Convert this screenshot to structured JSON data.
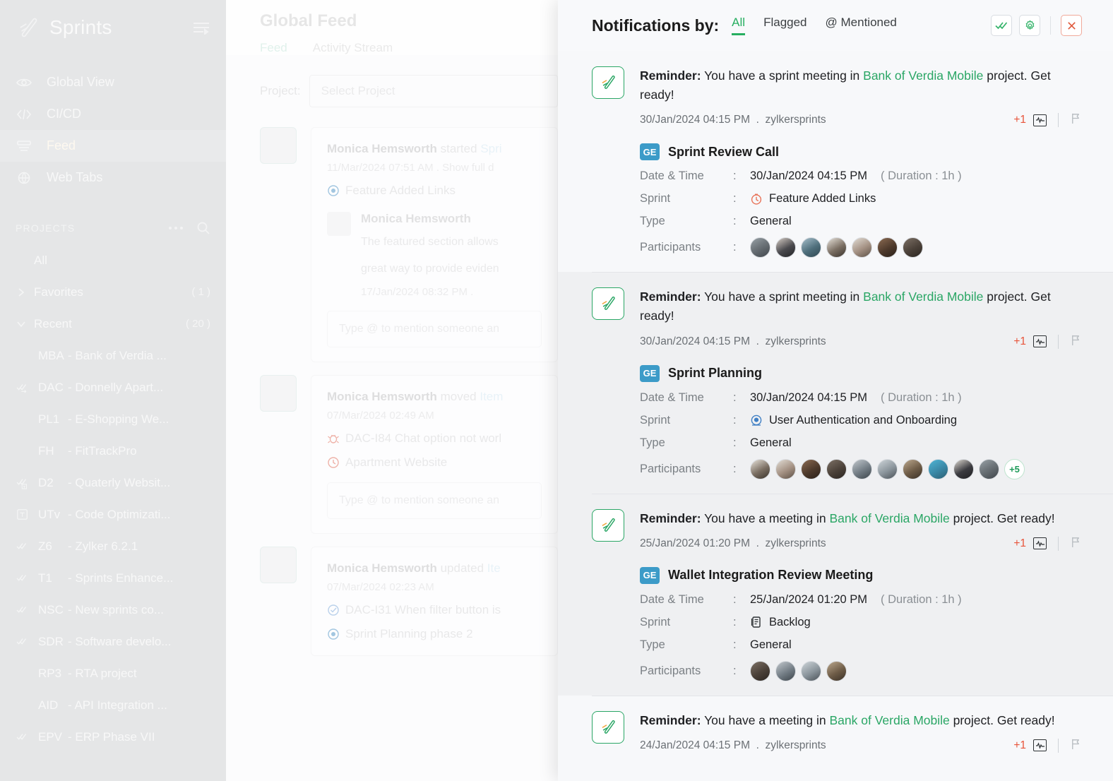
{
  "sidebar": {
    "brand": "Sprints",
    "nav": [
      {
        "label": "Global View",
        "icon": "eye-icon",
        "active": false
      },
      {
        "label": "CI/CD",
        "icon": "code-icon",
        "active": false
      },
      {
        "label": "Feed",
        "icon": "feed-icon",
        "active": true
      },
      {
        "label": "Web Tabs",
        "icon": "globe-icon",
        "active": false
      }
    ],
    "section_label": "PROJECTS",
    "section_actions": [
      "more-icon",
      "search-icon"
    ],
    "groups": [
      {
        "label": "All",
        "count": "",
        "caret": "none"
      },
      {
        "label": "Favorites",
        "count": "( 1 )",
        "caret": "right"
      },
      {
        "label": "Recent",
        "count": "( 20 )",
        "caret": "down"
      }
    ],
    "projects": [
      {
        "key": "MBA",
        "dash": "-",
        "name": "Bank of Verdia ...",
        "icon": "none"
      },
      {
        "key": "DAC",
        "dash": "-",
        "name": "Donnelly Apart...",
        "icon": "check-sync-icon"
      },
      {
        "key": "PL1",
        "dash": "-",
        "name": "E-Shopping We...",
        "icon": "none"
      },
      {
        "key": "FH",
        "dash": "-",
        "name": "FitTrackPro",
        "icon": "none"
      },
      {
        "key": "D2",
        "dash": "-",
        "name": "Quaterly Websit...",
        "icon": "check-t-icon"
      },
      {
        "key": "UTv",
        "dash": "-",
        "name": "Code Optimizati...",
        "icon": "square-t-icon"
      },
      {
        "key": "Z6",
        "dash": "-",
        "name": "Zylker 6.2.1",
        "icon": "check-icon"
      },
      {
        "key": "T1",
        "dash": "-",
        "name": "Sprints Enhance...",
        "icon": "check-icon"
      },
      {
        "key": "NSC",
        "dash": "-",
        "name": "New sprints co...",
        "icon": "check-icon"
      },
      {
        "key": "SDR",
        "dash": "-",
        "name": "Software develo...",
        "icon": "check-icon"
      },
      {
        "key": "RP3",
        "dash": "-",
        "name": "RTA project",
        "icon": "none"
      },
      {
        "key": "AID",
        "dash": "-",
        "name": "API Integration ...",
        "icon": "none"
      },
      {
        "key": "EPV",
        "dash": "-",
        "name": "ERP Phase VII",
        "icon": "check-icon"
      }
    ]
  },
  "feed": {
    "title": "Global Feed",
    "tabs": [
      {
        "label": "Feed",
        "active": true
      },
      {
        "label": "Activity Stream",
        "active": false
      }
    ],
    "project_label": "Project:",
    "project_placeholder": "Select Project",
    "cards": [
      {
        "actor": "Monica Hemsworth",
        "action": "started",
        "link": "Spri",
        "meta": "11/Mar/2024 07:51 AM  .  Show full d",
        "chip": "Feature Added Links",
        "chip_icon": "sprint-icon",
        "nested": {
          "name": "Monica Hemsworth",
          "text_line1": "The featured section allows",
          "text_line2": "great way to provide eviden",
          "meta": "17/Jan/2024 08:32 PM  ."
        },
        "reply_placeholder": "Type @ to mention someone an"
      },
      {
        "actor": "Monica Hemsworth",
        "action": "moved",
        "link": "Item",
        "meta": "07/Mar/2024 02:49 AM",
        "chip": "DAC-I84  Chat option not worl",
        "chip_icon": "bug-icon",
        "chip2": "Apartment Website",
        "chip2_icon": "clock-icon",
        "reply_placeholder": "Type @ to mention someone an"
      },
      {
        "actor": "Monica Hemsworth",
        "action": "updated",
        "link": "Ite",
        "meta": "07/Mar/2024 02:23 AM",
        "chip": "DAC-I31  When filter button is",
        "chip_icon": "task-check-icon",
        "chip2": "Sprint Planning phase 2",
        "chip2_icon": "sprint-icon"
      }
    ]
  },
  "panel": {
    "title": "Notifications by:",
    "filters": [
      {
        "label": "All",
        "active": true
      },
      {
        "label": "Flagged",
        "active": false
      },
      {
        "label": "@ Mentioned",
        "active": false
      }
    ],
    "actions": [
      {
        "name": "mark-all-read-button",
        "icon": "double-check-icon"
      },
      {
        "name": "settings-button",
        "icon": "gear-icon"
      },
      {
        "name": "close-button",
        "icon": "close-icon"
      }
    ],
    "labels": {
      "date_time": "Date & Time",
      "sprint": "Sprint",
      "type": "Type",
      "participants": "Participants",
      "colon": ":"
    },
    "notifications": [
      {
        "prefix": "Reminder:",
        "message_before": " You have a sprint meeting in ",
        "project": "Bank of Verdia Mobile",
        "message_after": " project. Get ready!",
        "timestamp": "30/Jan/2024 04:15 PM",
        "source": "zylkersprints",
        "badge": "+1",
        "shaded": false,
        "detail": {
          "type_badge": "GE",
          "title": "Sprint Review Call",
          "date_time": "30/Jan/2024 04:15 PM",
          "duration": "( Duration : 1h )",
          "sprint": "Feature Added Links",
          "sprint_icon": "clock-orange-icon",
          "meeting_type": "General",
          "participant_count": 7,
          "participants_more": ""
        }
      },
      {
        "prefix": "Reminder:",
        "message_before": " You have a sprint meeting in ",
        "project": "Bank of Verdia Mobile",
        "message_after": " project. Get ready!",
        "timestamp": "30/Jan/2024 04:15 PM",
        "source": "zylkersprints",
        "badge": "+1",
        "shaded": true,
        "detail": {
          "type_badge": "GE",
          "title": "Sprint Planning",
          "date_time": "30/Jan/2024 04:15 PM",
          "duration": "( Duration : 1h )",
          "sprint": "User Authentication and Onboarding",
          "sprint_icon": "sprint-blue-icon",
          "meeting_type": "General",
          "participant_count": 10,
          "participants_more": "+5"
        }
      },
      {
        "prefix": "Reminder:",
        "message_before": " You have a meeting in ",
        "project": "Bank of Verdia Mobile",
        "message_after": " project. Get ready!",
        "timestamp": "25/Jan/2024 01:20 PM",
        "source": "zylkersprints",
        "badge": "+1",
        "shaded": true,
        "detail": {
          "type_badge": "GE",
          "title": "Wallet Integration Review Meeting",
          "date_time": "25/Jan/2024 01:20 PM",
          "duration": "( Duration : 1h )",
          "sprint": "Backlog",
          "sprint_icon": "backlog-icon",
          "meeting_type": "General",
          "participant_count": 4,
          "participants_more": ""
        }
      },
      {
        "prefix": "Reminder:",
        "message_before": " You have a meeting in ",
        "project": "Bank of Verdia Mobile",
        "message_after": " project. Get ready!",
        "timestamp": "24/Jan/2024 04:15 PM",
        "source": "zylkersprints",
        "badge": "+1",
        "shaded": false,
        "detail": null
      }
    ]
  },
  "colors": {
    "brand_green": "#2aa665",
    "accent_green": "#27ae60",
    "badge_blue": "#3c9bc8",
    "alert_orange": "#e8543a",
    "close_red": "#e05a3d",
    "panel_bg": "#f7f8fa",
    "row_shaded": "#eff0f2",
    "sidebar_bg": "#e5e6e7"
  }
}
